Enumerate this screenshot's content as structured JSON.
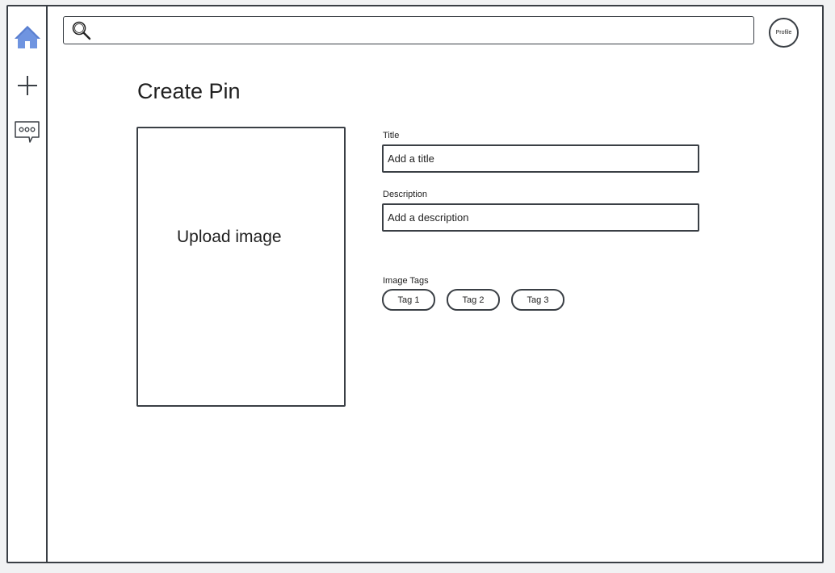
{
  "sidebar": {
    "items": [
      {
        "name": "home",
        "icon": "home-icon"
      },
      {
        "name": "create",
        "icon": "plus-icon"
      },
      {
        "name": "messages",
        "icon": "chat-bubble-icon"
      }
    ],
    "home_icon_color": "#6f94e0"
  },
  "header": {
    "search_placeholder": "",
    "profile_label": "Profile"
  },
  "main": {
    "title": "Create Pin",
    "upload_label": "Upload image",
    "title_field": {
      "label": "Title",
      "placeholder": "Add a title"
    },
    "description_field": {
      "label": "Description",
      "placeholder": "Add a description"
    },
    "tags_label": "Image Tags",
    "tags": [
      "Tag 1",
      "Tag 2",
      "Tag 3"
    ]
  }
}
